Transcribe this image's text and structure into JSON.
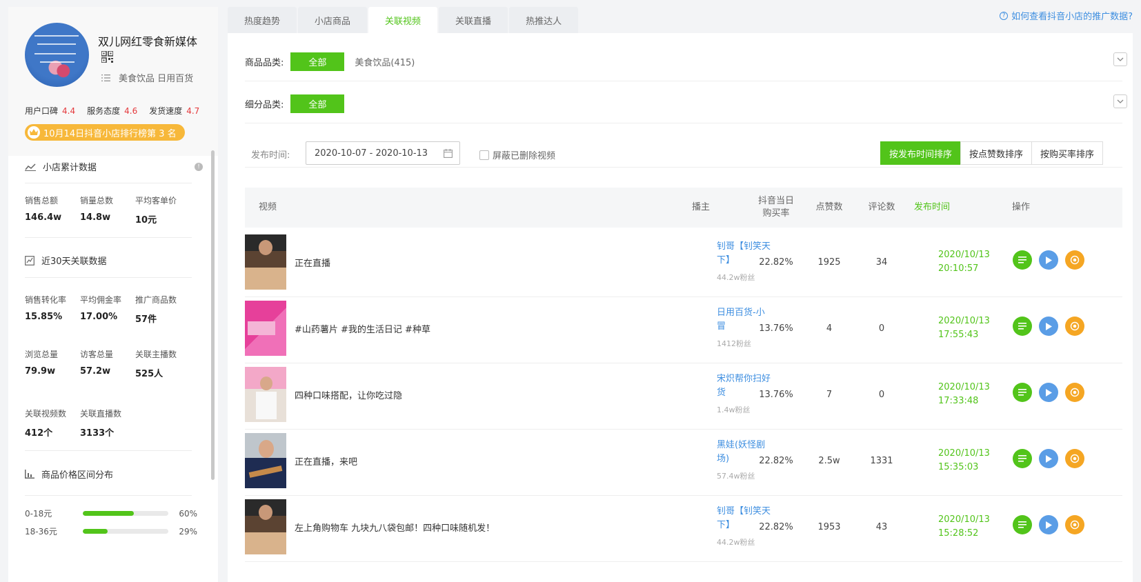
{
  "shop": {
    "name": "双儿网红零食新媒体",
    "categories": "美食饮品 日用百货",
    "scores": [
      {
        "label": "用户口碑",
        "value": "4.4"
      },
      {
        "label": "服务态度",
        "value": "4.6"
      },
      {
        "label": "发货速度",
        "value": "4.7"
      }
    ],
    "rank_text": "10月14日抖音小店排行榜第 3 名"
  },
  "cumulative": {
    "title": "小店累计数据",
    "metrics": [
      {
        "label": "销售总额",
        "value": "146.4w"
      },
      {
        "label": "销量总数",
        "value": "14.8w"
      },
      {
        "label": "平均客单价",
        "value": "10元"
      }
    ]
  },
  "recent": {
    "title": "近30天关联数据",
    "metrics": [
      {
        "label": "销售转化率",
        "value": "15.85%"
      },
      {
        "label": "平均佣金率",
        "value": "17.00%"
      },
      {
        "label": "推广商品数",
        "value": "57件"
      },
      {
        "label": "浏览总量",
        "value": "79.9w"
      },
      {
        "label": "访客总量",
        "value": "57.2w"
      },
      {
        "label": "关联主播数",
        "value": "525人"
      },
      {
        "label": "关联视频数",
        "value": "412个"
      },
      {
        "label": "关联直播数",
        "value": "3133个"
      }
    ]
  },
  "price_dist": {
    "title": "商品价格区间分布",
    "rows": [
      {
        "label": "0-18元",
        "pct": "60%",
        "fraction": 0.6
      },
      {
        "label": "18-36元",
        "pct": "29%",
        "fraction": 0.29
      }
    ]
  },
  "tabs": [
    {
      "label": "热度趋势"
    },
    {
      "label": "小店商品"
    },
    {
      "label": "关联视频"
    },
    {
      "label": "关联直播"
    },
    {
      "label": "热推达人"
    }
  ],
  "help_link": "如何查看抖音小店的推广数据?",
  "filters": {
    "goods_category_label": "商品品类:",
    "sub_category_label": "细分品类:",
    "all_label": "全部",
    "food_option": "美食饮品(415)",
    "publish_time_label": "发布时间:",
    "date_range": "2020-10-07 - 2020-10-13",
    "hide_deleted": "屏蔽已删除视频",
    "sort_options": [
      "按发布时间排序",
      "按点赞数排序",
      "按购买率排序"
    ]
  },
  "table": {
    "headers": {
      "video": "视频",
      "anchor": "播主",
      "rate_line1": "抖音当日",
      "rate_line2": "购买率",
      "likes": "点赞数",
      "comments": "评论数",
      "time": "发布时间",
      "ops": "操作"
    },
    "rows": [
      {
        "title": "正在直播",
        "anchor": "钊哥【钊笑天下】",
        "fans": "44.2w粉丝",
        "rate": "22.82%",
        "likes": "1925",
        "comments": "34",
        "date": "2020/10/13",
        "clock": "20:10:57"
      },
      {
        "title": "#山药薯片 #我的生活日记 #种草",
        "anchor": "日用百货-小冒",
        "fans": "1412粉丝",
        "rate": "13.76%",
        "likes": "4",
        "comments": "0",
        "date": "2020/10/13",
        "clock": "17:55:43"
      },
      {
        "title": "四种口味搭配，让你吃过隐",
        "anchor": "宋炽帮你扫好货",
        "fans": "1.4w粉丝",
        "rate": "13.76%",
        "likes": "7",
        "comments": "0",
        "date": "2020/10/13",
        "clock": "17:33:48"
      },
      {
        "title": "正在直播，来吧",
        "anchor": "黑娃(妖怪剧场)",
        "fans": "57.4w粉丝",
        "rate": "22.82%",
        "likes": "2.5w",
        "comments": "1331",
        "date": "2020/10/13",
        "clock": "15:35:03"
      },
      {
        "title": "左上角购物车 九块九八袋包邮！四种口味随机发！",
        "anchor": "钊哥【钊笑天下】",
        "fans": "44.2w粉丝",
        "rate": "22.82%",
        "likes": "1953",
        "comments": "43",
        "date": "2020/10/13",
        "clock": "15:28:52"
      }
    ]
  },
  "colors": {
    "accent": "#52c41a",
    "link": "#3d8ee0",
    "score": "#e4393c",
    "badge": "#f7b83a"
  }
}
